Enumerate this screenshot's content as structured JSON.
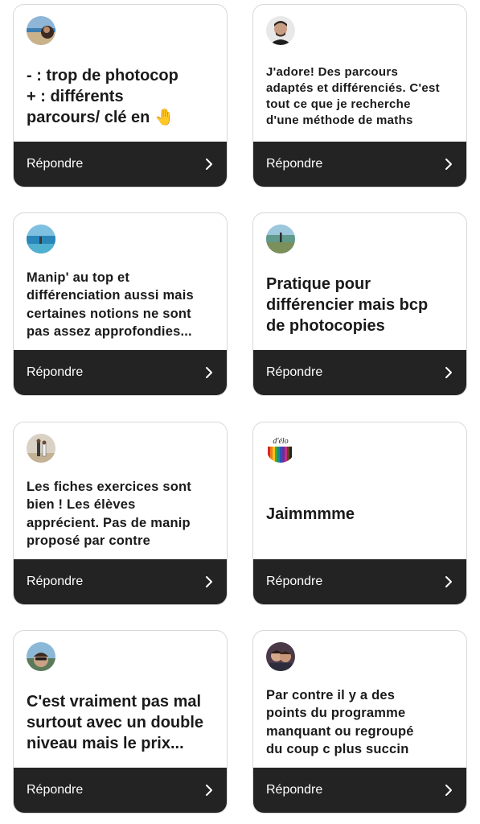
{
  "cards": [
    {
      "avatar_icon": "beach-avatar",
      "text": "- : trop de photocop\n+ : différents\nparcours/ clé en 🤚",
      "reply_label": "Répondre"
    },
    {
      "avatar_icon": "man-avatar",
      "text": "J'adore! Des parcours\nadaptés et différenciés. C'est\ntout ce que je recherche\nd'une méthode de maths",
      "reply_label": "Répondre"
    },
    {
      "avatar_icon": "sea-avatar",
      "text": "Manip' au top et\ndifférenciation aussi mais\ncertaines notions ne sont\npas assez approfondies...",
      "reply_label": "Répondre"
    },
    {
      "avatar_icon": "lake-avatar",
      "text": "Pratique pour\ndifférencier mais bcp\nde photocopies",
      "reply_label": "Répondre"
    },
    {
      "avatar_icon": "couple-beach-avatar",
      "text": "Les fiches exercices sont\nbien ! Les élèves\napprécient. Pas de manip\nproposé par contre",
      "reply_label": "Répondre"
    },
    {
      "avatar_icon": "pencils-avatar",
      "avatar_text": "d'élo",
      "text": "Jaimmmme",
      "reply_label": "Répondre"
    },
    {
      "avatar_icon": "selfie-avatar",
      "text": "C'est vraiment pas mal\nsurtout avec un double\nniveau mais le prix...",
      "reply_label": "Répondre"
    },
    {
      "avatar_icon": "couple-avatar",
      "text": "Par contre il y a des\npoints du programme\nmanquant ou regroupé\ndu coup c plus succin",
      "reply_label": "Répondre"
    }
  ]
}
